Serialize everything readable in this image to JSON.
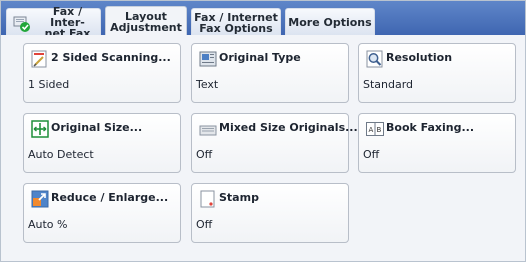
{
  "tabs": [
    {
      "label": "Fax / Inter-\nnet Fax"
    },
    {
      "label": "Layout\nAdjustment"
    },
    {
      "label": "Fax / Internet\nFax Options"
    },
    {
      "label": "More Options"
    }
  ],
  "cards": [
    {
      "title": "2 Sided Scanning...",
      "value": "1 Sided",
      "icon": "duplex-scan-icon"
    },
    {
      "title": "Original Type",
      "value": "Text",
      "icon": "original-type-icon"
    },
    {
      "title": "Resolution",
      "value": "Standard",
      "icon": "resolution-icon"
    },
    {
      "title": "Original Size...",
      "value": "Auto Detect",
      "icon": "original-size-icon"
    },
    {
      "title": "Mixed Size Originals...",
      "value": "Off",
      "icon": "mixed-size-icon"
    },
    {
      "title": "Book Faxing...",
      "value": "Off",
      "icon": "book-faxing-icon"
    },
    {
      "title": "Reduce / Enlarge...",
      "value": "Auto %",
      "icon": "reduce-enlarge-icon"
    },
    {
      "title": "Stamp",
      "value": "Off",
      "icon": "stamp-icon"
    }
  ],
  "colors": {
    "tab_bar": "#4a71bd",
    "panel": "#f2f4f8",
    "accent_green": "#22a63a"
  }
}
